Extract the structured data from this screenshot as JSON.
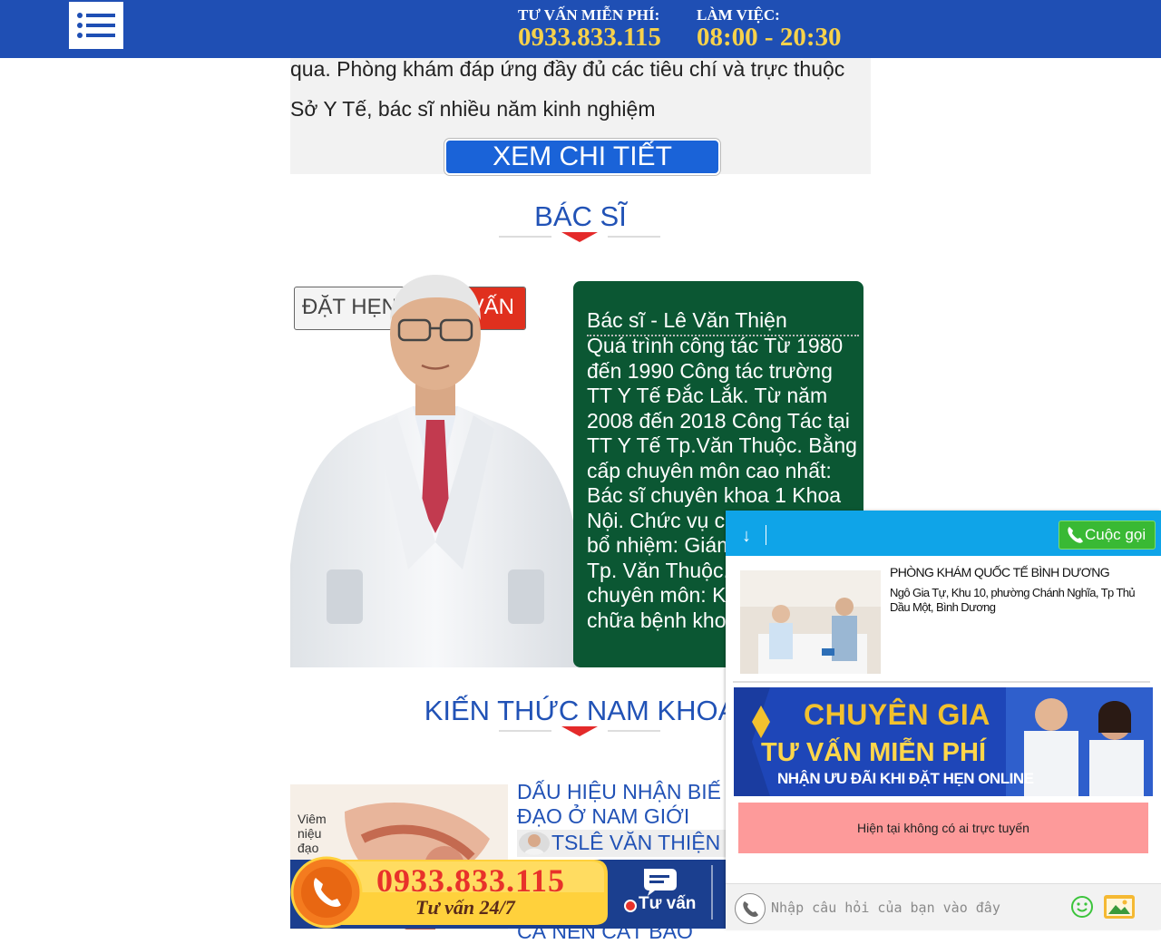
{
  "header": {
    "hotline_label": "TƯ VẤN MIỄN PHÍ:",
    "hotline_value": "0933.833.115",
    "hours_label": "LÀM VIỆC:",
    "hours_value": "08:00 - 20:30"
  },
  "intro": {
    "line1": "qua. Phòng khám đáp ứng đầy đủ các tiêu chí và trực thuộc",
    "line2": "Sở Y Tế, bác sĩ nhiều năm kinh nghiệm",
    "detail_button": "XEM CHI TIẾT"
  },
  "doctors": {
    "title": "BÁC SĨ",
    "book_button_left": "ĐẶT HẸN",
    "book_button_right": "VẤN",
    "name": "Bác sĩ - Lê Văn Thiện",
    "bio": "Quá trình công tác Từ 1980 đến 1990 Công tác trường TT Y Tế Đắc Lắk. Từ năm 2008 đến 2018 Công Tác tại TT Y Tế Tp.Văn Thuộc. Bằng cấp chuyên môn cao nhất: Bác sĩ chuyên khoa 1 Khoa Nội. Chức vụ cao nhất được bổ nhiệm: Giám đốc TT Y Tế Tp. Văn Thuộc. Sở trường chuyên môn: Khám bệnh, chữa bệnh khoa nội"
  },
  "knowledge": {
    "title": "KIẾN THỨC NAM KHOA",
    "article_title": "DẤU HIỆU NHẬN BIẾ\nĐẠO Ở NAM GIỚI",
    "image_label": "Viêm\nniệu\nđạo",
    "author": "TSLÊ VĂN THIỆN",
    "next_title": "CÁ NÊN CẮT BAO"
  },
  "hotline_bar": {
    "phone": "0933.833.115",
    "subtitle": "Tư vấn 24/7",
    "chat_label": "Tư vấn"
  },
  "chat": {
    "call_button": "Cuộc gọi",
    "clinic_name": "PHÒNG KHÁM QUỐC TẾ BÌNH DƯƠNG",
    "clinic_address": "Ngô Gia Tự, Khu 10, phường Chánh Nghĩa, Tp Thủ Dầu Một, Bình Dương",
    "banner_line1": "CHUYÊN GIA",
    "banner_line2": "TƯ VẤN MIỄN PHÍ",
    "banner_line3": "NHẬN ƯU ĐÃI KHI ĐẶT HẸN ONLINE",
    "offline_text": "Hiện tại không có ai trực tuyến",
    "input_placeholder": "Nhập câu hỏi của bạn vào đây"
  },
  "colors": {
    "header_bg": "#1f4fb4",
    "header_value": "#f7d24b",
    "section_title": "#2152b6",
    "doctor_card_bg": "#0b5733",
    "chat_header_bg": "#0fa4e8",
    "call_button_bg": "#39b934",
    "offline_bg": "#fd9a9a",
    "book_button_accent": "#e0301e"
  },
  "icons": [
    "menu-icon",
    "arrow-down-icon",
    "phone-icon",
    "chat-bubble-icon",
    "emoji-icon",
    "image-upload-icon"
  ]
}
